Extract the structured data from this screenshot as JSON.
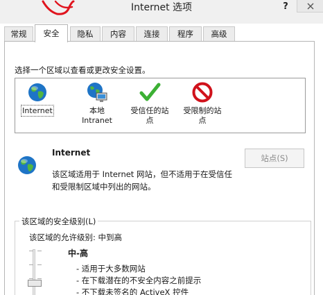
{
  "window": {
    "title": "Internet 选项",
    "help_label": "?"
  },
  "tabs": [
    {
      "label": "常规"
    },
    {
      "label": "安全"
    },
    {
      "label": "隐私"
    },
    {
      "label": "内容"
    },
    {
      "label": "连接"
    },
    {
      "label": "程序"
    },
    {
      "label": "高级"
    }
  ],
  "active_tab": "安全",
  "security": {
    "prompt": "选择一个区域以查看或更改安全设置。",
    "zones": [
      {
        "line1": "Internet",
        "line2": "",
        "icon": "globe-icon"
      },
      {
        "line1": "本地",
        "line2": "Intranet",
        "icon": "local-intranet-icon"
      },
      {
        "line1": "受信任的站",
        "line2": "点",
        "icon": "checkmark-icon"
      },
      {
        "line1": "受限制的站",
        "line2": "点",
        "icon": "restricted-icon"
      }
    ],
    "selected_zone": {
      "title": "Internet",
      "desc_line1": "该区域适用于 Internet 网站，但不适用于在受信任",
      "desc_line2": "和受限制区域中列出的网站。"
    },
    "sites_button": "站点(S)",
    "level_group": {
      "legend": "该区域的安全级别(L)",
      "allowed": "该区域的允许级别: 中到高",
      "level_name": "中-高",
      "items": [
        "- 适用于大多数网站",
        "- 在下载潜在的不安全内容之前提示",
        "- 不下载未签名的 ActiveX 控件"
      ]
    }
  },
  "colors": {
    "scribble": "#e0141e",
    "check_green": "#3cb034",
    "restricted_red": "#d0121b",
    "globe_blue": "#1e74c6"
  }
}
